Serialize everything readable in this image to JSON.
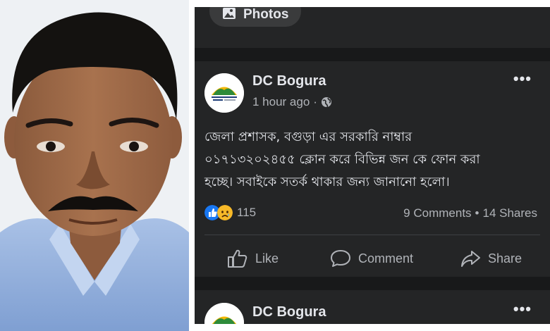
{
  "top_card": {
    "photos_label": "Photos"
  },
  "post": {
    "author": "DC Bogura",
    "time": "1 hour ago",
    "separator": "·",
    "privacy_icon": "globe-icon",
    "text_lines": [
      "জেলা প্রশাসক, বগুড়া এর সরকারি নাম্বার",
      "০১৭১৩২০২৪৫৫ ক্লোন করে বিভিন্ন জন কে ফোন করা",
      "হচ্ছে। সবাইকে সতর্ক থাকার জন্য জানানো হলো।"
    ],
    "reactions": {
      "icons": [
        "like-reaction-icon",
        "sad-reaction-icon"
      ],
      "count": "115"
    },
    "comments": "9 Comments",
    "stats_separator": "•",
    "shares": "14 Shares",
    "actions": {
      "like": "Like",
      "comment": "Comment",
      "share": "Share"
    },
    "more": "•••"
  },
  "next_post": {
    "author": "DC Bogura",
    "more": "•••"
  },
  "colors": {
    "feed_bg": "#18191a",
    "card_bg": "#242526",
    "primary_text": "#e4e6eb",
    "secondary_text": "#b0b3b8",
    "like_blue": "#1877f2",
    "sad_yellow": "#f7b928"
  }
}
